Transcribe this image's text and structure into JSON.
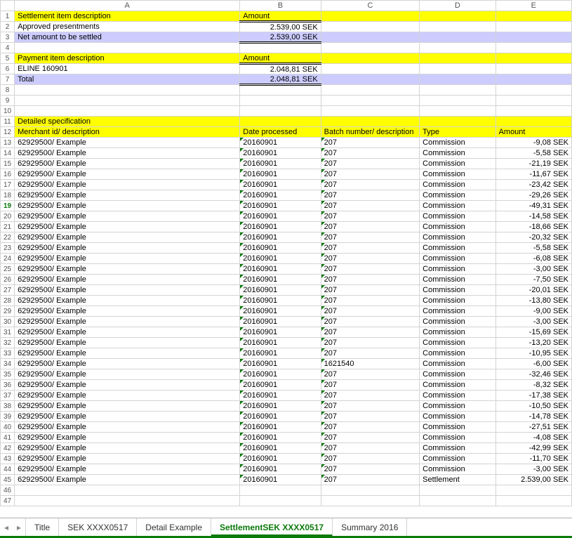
{
  "columns": [
    "A",
    "B",
    "C",
    "D",
    "E"
  ],
  "rows": [
    {
      "n": 1,
      "cls": "yellow",
      "c": [
        "Settlement item description",
        "Amount",
        "",
        "",
        ""
      ]
    },
    {
      "n": 2,
      "c": [
        "Approved presentments",
        {
          "v": "2.539,00 SEK",
          "r": 1,
          "dt": 1
        },
        "",
        "",
        ""
      ]
    },
    {
      "n": 3,
      "cls": "lav",
      "c": [
        "Net amount to be settled",
        {
          "v": "2.539,00 SEK",
          "r": 1,
          "db": 1
        },
        "",
        "",
        ""
      ]
    },
    {
      "n": 4,
      "c": [
        "",
        "",
        "",
        "",
        ""
      ]
    },
    {
      "n": 5,
      "cls": "yellow",
      "c": [
        "Payment item description",
        "Amount",
        "",
        "",
        ""
      ]
    },
    {
      "n": 6,
      "c": [
        "ELINE 160901",
        {
          "v": "2.048,81 SEK",
          "r": 1,
          "dt": 1
        },
        "",
        "",
        ""
      ]
    },
    {
      "n": 7,
      "cls": "lav",
      "c": [
        "Total",
        {
          "v": "2.048,81 SEK",
          "r": 1,
          "db": 1
        },
        "",
        "",
        ""
      ]
    },
    {
      "n": 8,
      "c": [
        "",
        "",
        "",
        "",
        ""
      ]
    },
    {
      "n": 9,
      "c": [
        "",
        "",
        "",
        "",
        ""
      ]
    },
    {
      "n": 10,
      "c": [
        "",
        "",
        "",
        "",
        ""
      ]
    },
    {
      "n": 11,
      "cls": "yellow",
      "c": [
        "Detailed specification",
        "",
        "",
        "",
        ""
      ]
    },
    {
      "n": 12,
      "cls": "yellow",
      "c": [
        "Merchant id/ description",
        "Date processed",
        "Batch number/ description",
        "Type",
        "Amount"
      ]
    },
    {
      "n": 13,
      "c": [
        "62929500/ Example",
        {
          "v": "20160901",
          "t": 1
        },
        {
          "v": "207",
          "t": 1
        },
        "Commission",
        {
          "v": "-9,08 SEK",
          "r": 1
        }
      ]
    },
    {
      "n": 14,
      "c": [
        "62929500/ Example",
        {
          "v": "20160901",
          "t": 1
        },
        {
          "v": "207",
          "t": 1
        },
        "Commission",
        {
          "v": "-5,58 SEK",
          "r": 1
        }
      ]
    },
    {
      "n": 15,
      "c": [
        "62929500/ Example",
        {
          "v": "20160901",
          "t": 1
        },
        {
          "v": "207",
          "t": 1
        },
        "Commission",
        {
          "v": "-21,19 SEK",
          "r": 1
        }
      ]
    },
    {
      "n": 16,
      "c": [
        "62929500/ Example",
        {
          "v": "20160901",
          "t": 1
        },
        {
          "v": "207",
          "t": 1
        },
        "Commission",
        {
          "v": "-11,67 SEK",
          "r": 1
        }
      ]
    },
    {
      "n": 17,
      "c": [
        "62929500/ Example",
        {
          "v": "20160901",
          "t": 1
        },
        {
          "v": "207",
          "t": 1
        },
        "Commission",
        {
          "v": "-23,42 SEK",
          "r": 1
        }
      ]
    },
    {
      "n": 18,
      "c": [
        "62929500/ Example",
        {
          "v": "20160901",
          "t": 1
        },
        {
          "v": "207",
          "t": 1
        },
        "Commission",
        {
          "v": "-29,26 SEK",
          "r": 1
        }
      ]
    },
    {
      "n": 19,
      "green": 1,
      "c": [
        "62929500/ Example",
        {
          "v": "20160901",
          "t": 1
        },
        {
          "v": "207",
          "t": 1
        },
        "Commission",
        {
          "v": "-49,31 SEK",
          "r": 1
        }
      ]
    },
    {
      "n": 20,
      "c": [
        "62929500/ Example",
        {
          "v": "20160901",
          "t": 1
        },
        {
          "v": "207",
          "t": 1
        },
        "Commission",
        {
          "v": "-14,58 SEK",
          "r": 1
        }
      ]
    },
    {
      "n": 21,
      "c": [
        "62929500/ Example",
        {
          "v": "20160901",
          "t": 1
        },
        {
          "v": "207",
          "t": 1
        },
        "Commission",
        {
          "v": "-18,66 SEK",
          "r": 1
        }
      ]
    },
    {
      "n": 22,
      "c": [
        "62929500/ Example",
        {
          "v": "20160901",
          "t": 1
        },
        {
          "v": "207",
          "t": 1
        },
        "Commission",
        {
          "v": "-20,32 SEK",
          "r": 1
        }
      ]
    },
    {
      "n": 23,
      "c": [
        "62929500/ Example",
        {
          "v": "20160901",
          "t": 1
        },
        {
          "v": "207",
          "t": 1
        },
        "Commission",
        {
          "v": "-5,58 SEK",
          "r": 1
        }
      ]
    },
    {
      "n": 24,
      "c": [
        "62929500/ Example",
        {
          "v": "20160901",
          "t": 1
        },
        {
          "v": "207",
          "t": 1
        },
        "Commission",
        {
          "v": "-6,08 SEK",
          "r": 1
        }
      ]
    },
    {
      "n": 25,
      "c": [
        "62929500/ Example",
        {
          "v": "20160901",
          "t": 1
        },
        {
          "v": "207",
          "t": 1
        },
        "Commission",
        {
          "v": "-3,00 SEK",
          "r": 1
        }
      ]
    },
    {
      "n": 26,
      "c": [
        "62929500/ Example",
        {
          "v": "20160901",
          "t": 1
        },
        {
          "v": "207",
          "t": 1
        },
        "Commission",
        {
          "v": "-7,50 SEK",
          "r": 1
        }
      ]
    },
    {
      "n": 27,
      "c": [
        "62929500/ Example",
        {
          "v": "20160901",
          "t": 1
        },
        {
          "v": "207",
          "t": 1
        },
        "Commission",
        {
          "v": "-20,01 SEK",
          "r": 1
        }
      ]
    },
    {
      "n": 28,
      "c": [
        "62929500/ Example",
        {
          "v": "20160901",
          "t": 1
        },
        {
          "v": "207",
          "t": 1
        },
        "Commission",
        {
          "v": "-13,80 SEK",
          "r": 1
        }
      ]
    },
    {
      "n": 29,
      "c": [
        "62929500/ Example",
        {
          "v": "20160901",
          "t": 1
        },
        {
          "v": "207",
          "t": 1
        },
        "Commission",
        {
          "v": "-9,00 SEK",
          "r": 1
        }
      ]
    },
    {
      "n": 30,
      "c": [
        "62929500/ Example",
        {
          "v": "20160901",
          "t": 1
        },
        {
          "v": "207",
          "t": 1
        },
        "Commission",
        {
          "v": "-3,00 SEK",
          "r": 1
        }
      ]
    },
    {
      "n": 31,
      "c": [
        "62929500/ Example",
        {
          "v": "20160901",
          "t": 1
        },
        {
          "v": "207",
          "t": 1
        },
        "Commission",
        {
          "v": "-15,69 SEK",
          "r": 1
        }
      ]
    },
    {
      "n": 32,
      "c": [
        "62929500/ Example",
        {
          "v": "20160901",
          "t": 1
        },
        {
          "v": "207",
          "t": 1
        },
        "Commission",
        {
          "v": "-13,20 SEK",
          "r": 1
        }
      ]
    },
    {
      "n": 33,
      "c": [
        "62929500/ Example",
        {
          "v": "20160901",
          "t": 1
        },
        {
          "v": "207",
          "t": 1
        },
        "Commission",
        {
          "v": "-10,95 SEK",
          "r": 1
        }
      ]
    },
    {
      "n": 34,
      "c": [
        "62929500/ Example",
        {
          "v": "20160901",
          "t": 1
        },
        {
          "v": "1621540",
          "t": 1
        },
        "Commission",
        {
          "v": "-6,00 SEK",
          "r": 1
        }
      ]
    },
    {
      "n": 35,
      "c": [
        "62929500/ Example",
        {
          "v": "20160901",
          "t": 1
        },
        {
          "v": "207",
          "t": 1
        },
        "Commission",
        {
          "v": "-32,46 SEK",
          "r": 1
        }
      ]
    },
    {
      "n": 36,
      "c": [
        "62929500/ Example",
        {
          "v": "20160901",
          "t": 1
        },
        {
          "v": "207",
          "t": 1
        },
        "Commission",
        {
          "v": "-8,32 SEK",
          "r": 1
        }
      ]
    },
    {
      "n": 37,
      "c": [
        "62929500/ Example",
        {
          "v": "20160901",
          "t": 1
        },
        {
          "v": "207",
          "t": 1
        },
        "Commission",
        {
          "v": "-17,38 SEK",
          "r": 1
        }
      ]
    },
    {
      "n": 38,
      "c": [
        "62929500/ Example",
        {
          "v": "20160901",
          "t": 1
        },
        {
          "v": "207",
          "t": 1
        },
        "Commission",
        {
          "v": "-10,50 SEK",
          "r": 1
        }
      ]
    },
    {
      "n": 39,
      "c": [
        "62929500/ Example",
        {
          "v": "20160901",
          "t": 1
        },
        {
          "v": "207",
          "t": 1
        },
        "Commission",
        {
          "v": "-14,78 SEK",
          "r": 1
        }
      ]
    },
    {
      "n": 40,
      "c": [
        "62929500/ Example",
        {
          "v": "20160901",
          "t": 1
        },
        {
          "v": "207",
          "t": 1
        },
        "Commission",
        {
          "v": "-27,51 SEK",
          "r": 1
        }
      ]
    },
    {
      "n": 41,
      "c": [
        "62929500/ Example",
        {
          "v": "20160901",
          "t": 1
        },
        {
          "v": "207",
          "t": 1
        },
        "Commission",
        {
          "v": "-4,08 SEK",
          "r": 1
        }
      ]
    },
    {
      "n": 42,
      "c": [
        "62929500/ Example",
        {
          "v": "20160901",
          "t": 1
        },
        {
          "v": "207",
          "t": 1
        },
        "Commission",
        {
          "v": "-42,99 SEK",
          "r": 1
        }
      ]
    },
    {
      "n": 43,
      "c": [
        "62929500/ Example",
        {
          "v": "20160901",
          "t": 1
        },
        {
          "v": "207",
          "t": 1
        },
        "Commission",
        {
          "v": "-11,70 SEK",
          "r": 1
        }
      ]
    },
    {
      "n": 44,
      "c": [
        "62929500/ Example",
        {
          "v": "20160901",
          "t": 1
        },
        {
          "v": "207",
          "t": 1
        },
        "Commission",
        {
          "v": "-3,00 SEK",
          "r": 1
        }
      ]
    },
    {
      "n": 45,
      "c": [
        "62929500/ Example",
        {
          "v": "20160901",
          "t": 1
        },
        {
          "v": "207",
          "t": 1
        },
        "Settlement",
        {
          "v": "2.539,00 SEK",
          "r": 1
        }
      ]
    },
    {
      "n": 46,
      "c": [
        "",
        "",
        "",
        "",
        ""
      ]
    },
    {
      "n": 47,
      "c": [
        "",
        "",
        "",
        "",
        ""
      ]
    }
  ],
  "tabs": [
    {
      "label": "Title"
    },
    {
      "label": "SEK XXXX0517"
    },
    {
      "label": "Detail Example"
    },
    {
      "label": "SettlementSEK XXXX0517",
      "active": true
    },
    {
      "label": "Summary 2016"
    }
  ],
  "nav": {
    "prev": "◂",
    "next": "▸"
  }
}
